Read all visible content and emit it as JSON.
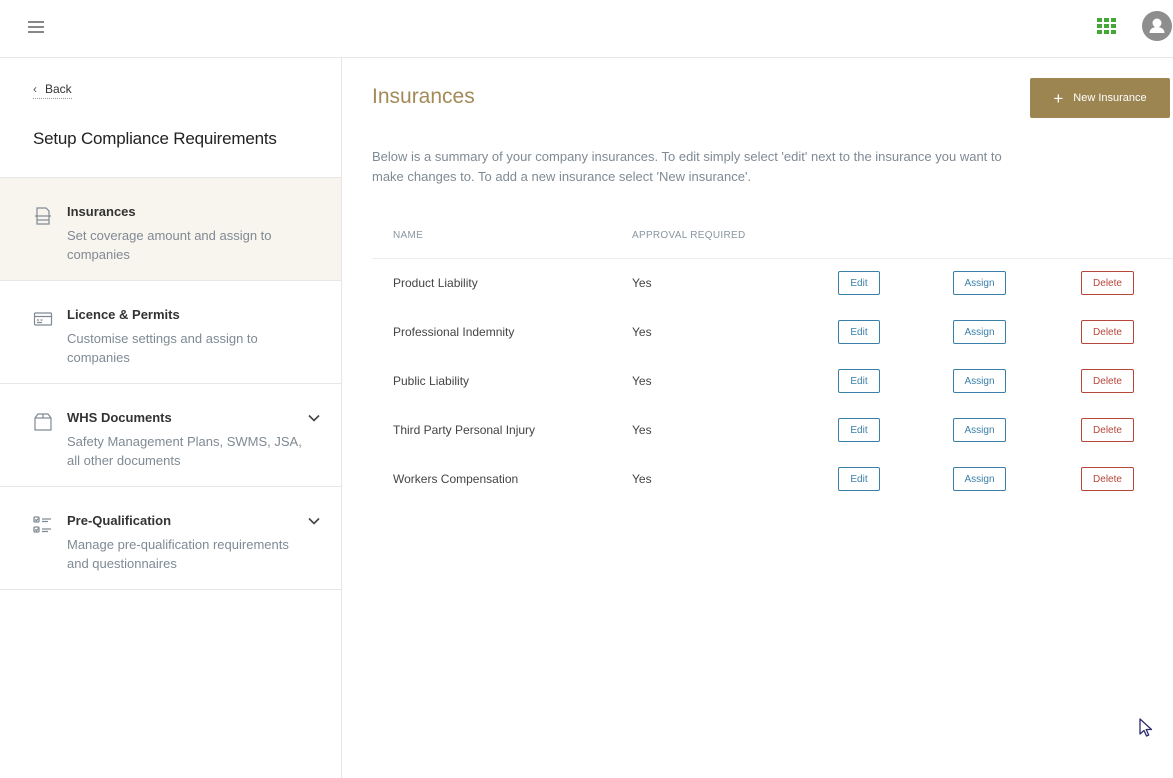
{
  "sidebar": {
    "back_label": "Back",
    "title": "Setup Compliance Requirements",
    "items": [
      {
        "label": "Insurances",
        "desc": "Set coverage amount and assign to companies",
        "icon": "document-icon",
        "active": true
      },
      {
        "label": "Licence & Permits",
        "desc": "Customise settings and assign to companies",
        "icon": "id-card-icon"
      },
      {
        "label": "WHS Documents",
        "desc": "Safety Management Plans, SWMS, JSA, all other documents",
        "icon": "box-icon",
        "expandable": true
      },
      {
        "label": "Pre-Qualification",
        "desc": "Manage pre-qualification requirements and questionnaires",
        "icon": "checklist-icon",
        "expandable": true
      }
    ]
  },
  "main": {
    "title": "Insurances",
    "new_button_label": "New Insurance",
    "intro": "Below is a summary of your company insurances. To edit simply select 'edit' next to the insurance you want to make changes to. To add a new insurance select 'New insurance'.",
    "table": {
      "headers": {
        "name": "NAME",
        "approval": "APPROVAL REQUIRED"
      },
      "actions": {
        "edit": "Edit",
        "assign": "Assign",
        "delete": "Delete"
      },
      "rows": [
        {
          "name": "Product Liability",
          "approval": "Yes"
        },
        {
          "name": "Professional Indemnity",
          "approval": "Yes"
        },
        {
          "name": "Public Liability",
          "approval": "Yes"
        },
        {
          "name": "Third Party Personal Injury",
          "approval": "Yes"
        },
        {
          "name": "Workers Compensation",
          "approval": "Yes"
        }
      ]
    }
  },
  "colors": {
    "accent_gold": "#9c8550",
    "title_gold": "#a48a58",
    "link_blue": "#3a7fa8",
    "danger_red": "#b5463a",
    "apps_green": "#43a835",
    "active_bg": "#f8f4ee"
  }
}
